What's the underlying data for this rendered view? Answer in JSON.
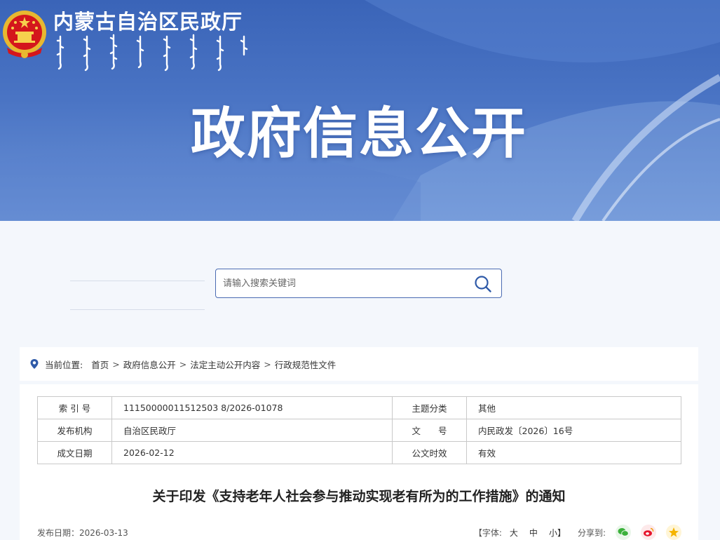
{
  "header": {
    "site_name": "内蒙古自治区民政厅",
    "banner_title": "政府信息公开",
    "emblem_icon": "national-emblem-icon"
  },
  "search": {
    "placeholder": "请输入搜索关键词",
    "icon": "search-icon"
  },
  "breadcrumb": {
    "prefix": "当前位置:",
    "items": [
      "首页",
      "政府信息公开",
      "法定主动公开内容",
      "行政规范性文件"
    ],
    "separator": ">"
  },
  "meta_table": {
    "rows": [
      {
        "k1": "索 引 号",
        "v1": "11150000011512503 8/2026-01078",
        "k2": "主题分类",
        "v2": "其他"
      },
      {
        "k1": "发布机构",
        "v1": "自治区民政厅",
        "k2": "文　　号",
        "v2": "内民政发〔2026〕16号"
      },
      {
        "k1": "成文日期",
        "v1": "2026-02-12",
        "k2": "公文时效",
        "v2": "有效"
      }
    ]
  },
  "document": {
    "title": "关于印发《支持老年人社会参与推动实现老有所为的工作措施》的通知",
    "pub_date": "发布日期：2026-03-13",
    "font_label_open": "【字体:",
    "font_large": "大",
    "font_medium": "中",
    "font_small": "小】",
    "share_label": "分享到:"
  },
  "colors": {
    "banner": "#3a64b8",
    "accent": "#4a6bb2",
    "wechat": "#3bb13b",
    "weibo": "#e6162d",
    "qzone": "#f5b400"
  }
}
